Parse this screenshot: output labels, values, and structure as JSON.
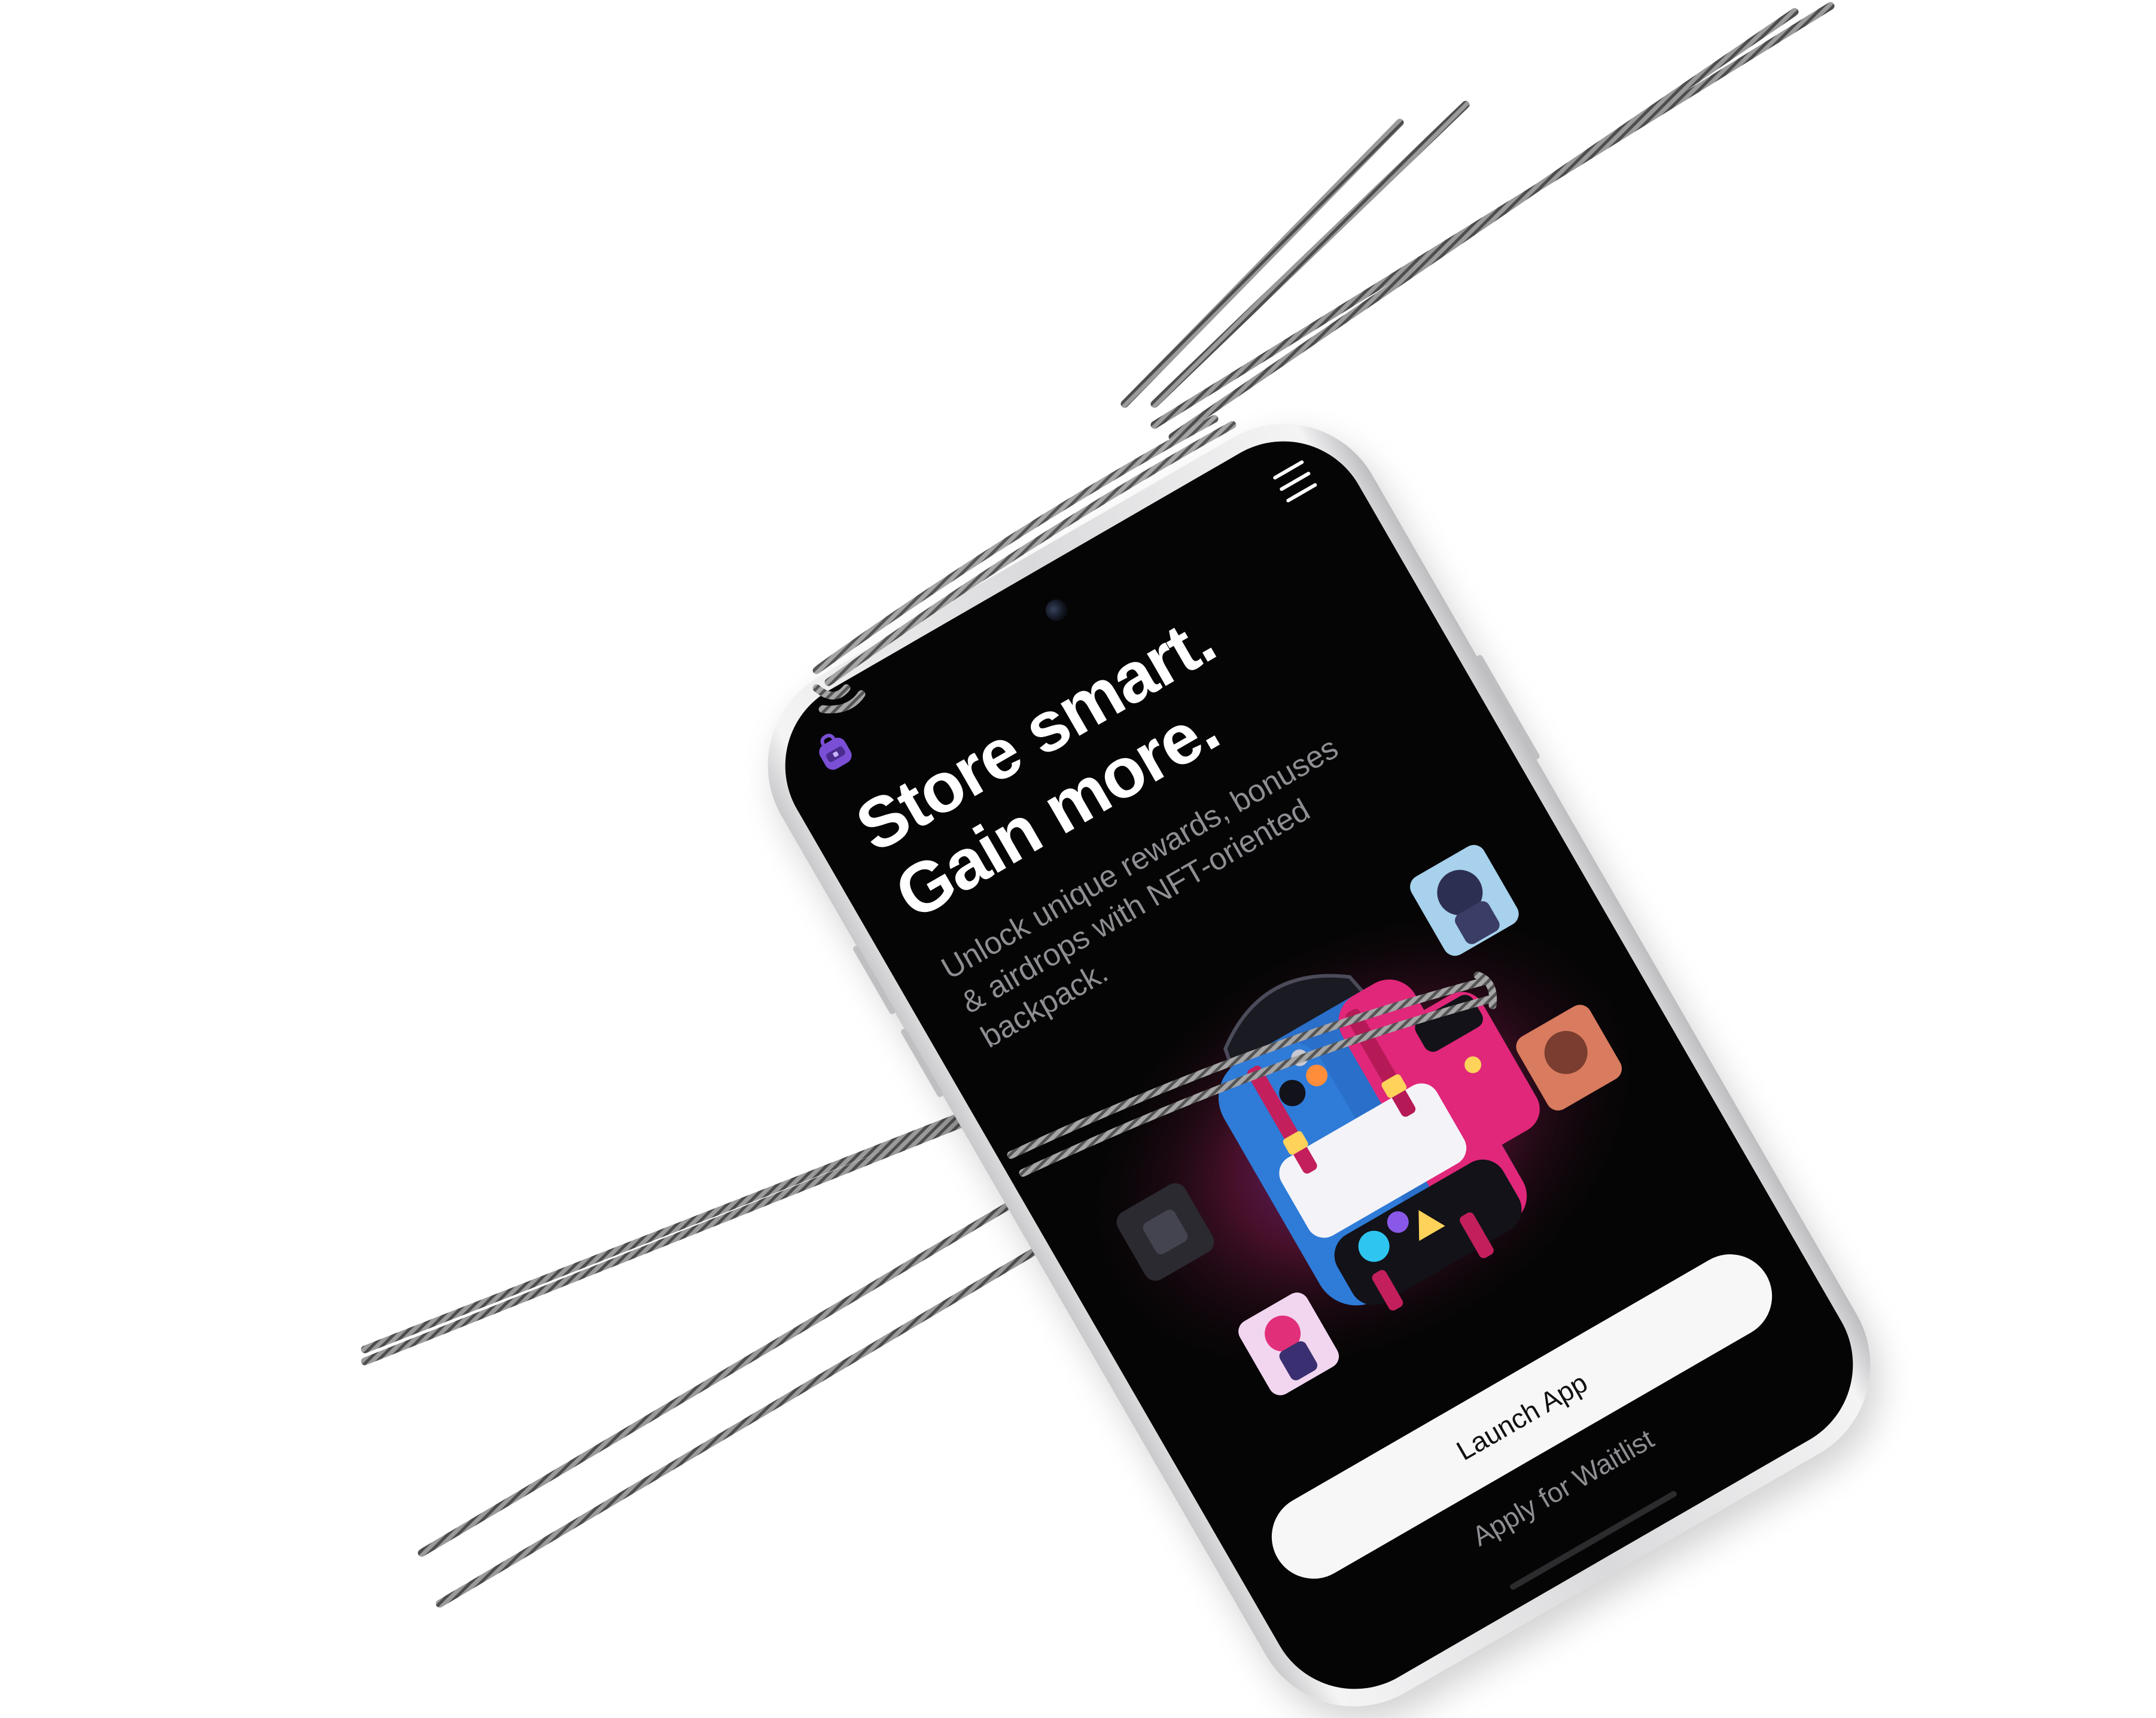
{
  "app": {
    "logo_icon": "backpack-logo-icon",
    "menu_icon": "hamburger-menu-icon"
  },
  "hero": {
    "headline_line1": "Store smart.",
    "headline_line2": "Gain more.",
    "subtitle": "Unlock unique rewards, bonuses & airdrops with NFT-oriented backpack.",
    "illustration": "nft-backpack-illustration"
  },
  "actions": {
    "launch_label": "Launch App",
    "waitlist_label": "Apply for Waitlist"
  },
  "colors": {
    "screen_bg": "#050505",
    "accent_purple": "#7a4fd6",
    "accent_pink": "#e0277a",
    "accent_blue": "#2a6fc9",
    "button_bg": "#f7f7f8",
    "muted_text": "#8e8e93",
    "rope": "#8a8a8a"
  }
}
